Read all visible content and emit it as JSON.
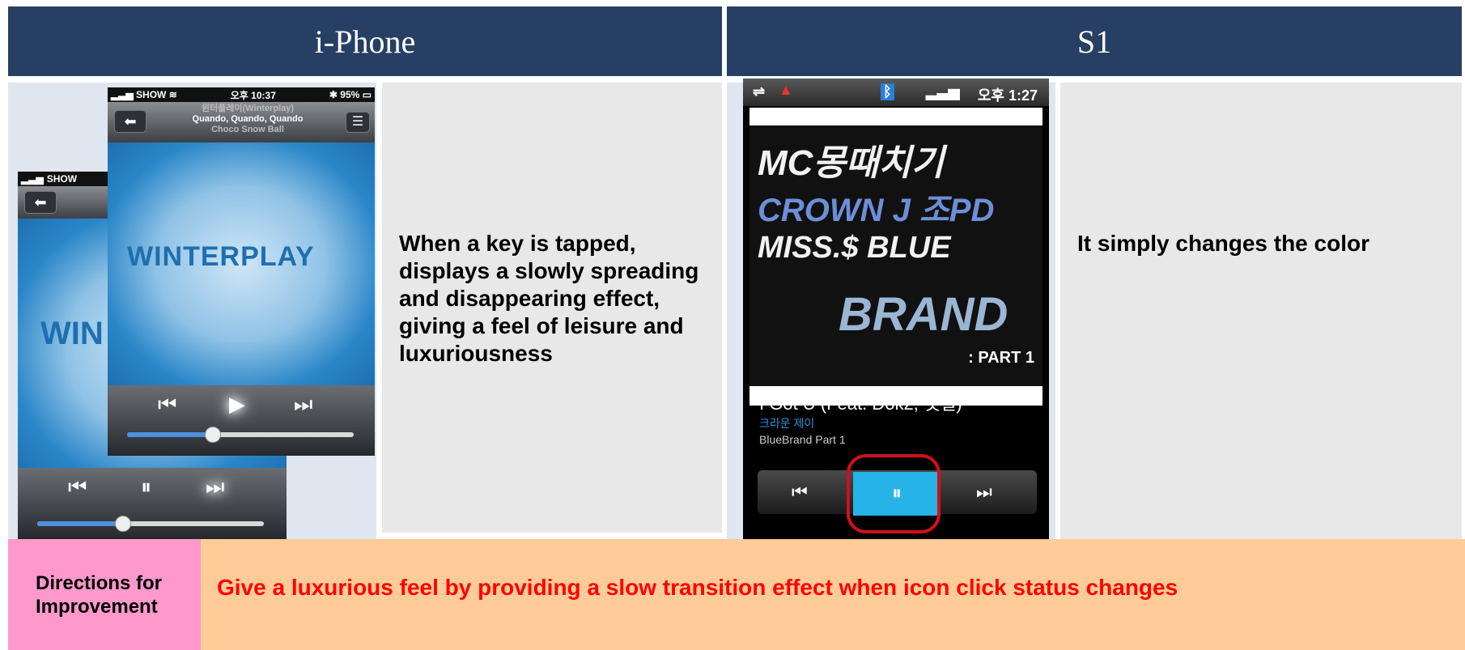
{
  "columns": {
    "left_header": "i-Phone",
    "right_header": "S1"
  },
  "iphone_back": {
    "carrier": "SHOW",
    "art_title": "WIN"
  },
  "iphone_front": {
    "carrier": "SHOW",
    "time": "오후 10:37",
    "battery": "95%",
    "artist_line": "윈터플레이(Winterplay)",
    "track_line": "Quando, Quando, Quando",
    "album_line": "Choco Snow Ball",
    "art_title": "WINTERPLAY",
    "progress": 0.36
  },
  "iphone_description": "When a key is tapped, displays a slowly spreading and disappearing effect, giving a feel of leisure and luxuriousness",
  "s1": {
    "time": "오후 1:27",
    "art_lines": [
      "MC몽때치기",
      "CROWN J 조PD",
      "MISS.$ BLUE",
      "BRAND"
    ],
    "art_part": ": PART 1",
    "song_title": "I Got U (Feat. Dok2, 샛별)",
    "artist": "크라운 제이",
    "album": "BlueBrand Part 1",
    "accent_color": "#26b3e6",
    "highlight_color": "#d0101c"
  },
  "s1_description": "It simply changes the color",
  "footer": {
    "label": "Directions for Improvement",
    "text": "Give a luxurious feel by providing a slow transition effect when icon click status changes",
    "text_color": "#ff0000"
  }
}
